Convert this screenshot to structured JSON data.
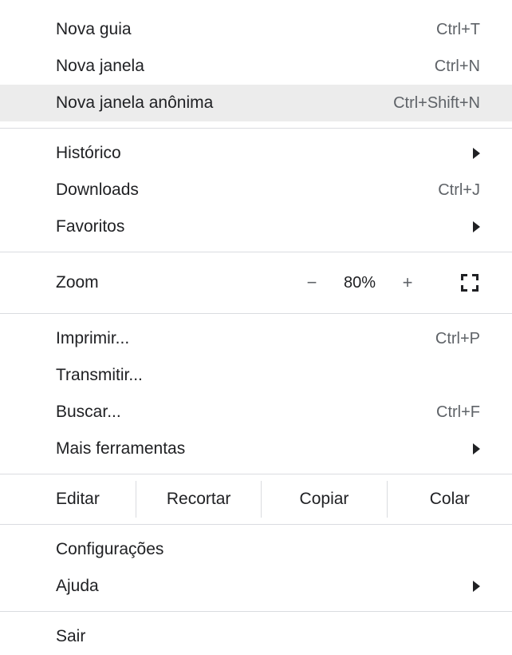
{
  "menu": {
    "newTab": {
      "label": "Nova guia",
      "shortcut": "Ctrl+T"
    },
    "newWindow": {
      "label": "Nova janela",
      "shortcut": "Ctrl+N"
    },
    "newIncognito": {
      "label": "Nova janela anônima",
      "shortcut": "Ctrl+Shift+N"
    },
    "history": {
      "label": "Histórico"
    },
    "downloads": {
      "label": "Downloads",
      "shortcut": "Ctrl+J"
    },
    "bookmarks": {
      "label": "Favoritos"
    },
    "zoom": {
      "label": "Zoom",
      "value": "80%",
      "minus": "−",
      "plus": "+"
    },
    "print": {
      "label": "Imprimir...",
      "shortcut": "Ctrl+P"
    },
    "cast": {
      "label": "Transmitir..."
    },
    "find": {
      "label": "Buscar...",
      "shortcut": "Ctrl+F"
    },
    "moreTools": {
      "label": "Mais ferramentas"
    },
    "edit": {
      "label": "Editar",
      "cut": "Recortar",
      "copy": "Copiar",
      "paste": "Colar"
    },
    "settings": {
      "label": "Configurações"
    },
    "help": {
      "label": "Ajuda"
    },
    "exit": {
      "label": "Sair"
    }
  }
}
